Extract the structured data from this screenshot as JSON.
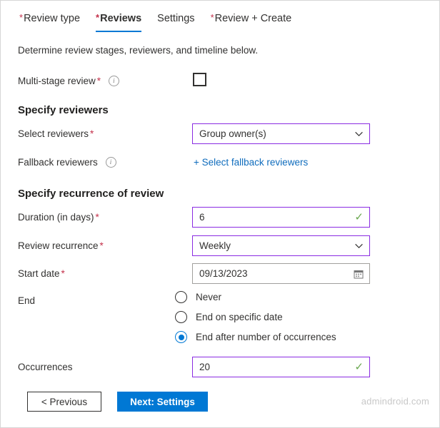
{
  "tabs": [
    {
      "label": "Review type",
      "required": true,
      "active": false
    },
    {
      "label": "Reviews",
      "required": true,
      "active": true
    },
    {
      "label": "Settings",
      "required": false,
      "active": false
    },
    {
      "label": "Review + Create",
      "required": true,
      "active": false
    }
  ],
  "intro": "Determine review stages, reviewers, and timeline below.",
  "multi_stage": {
    "label": "Multi-stage review",
    "required_mark": "*",
    "info_icon": "info-icon",
    "checked": false
  },
  "sections": {
    "reviewers_title": "Specify reviewers",
    "recurrence_title": "Specify recurrence of review"
  },
  "fields": {
    "select_reviewers": {
      "label": "Select reviewers",
      "required_mark": "*",
      "value": "Group owner(s)",
      "icon": "chevron-down-icon"
    },
    "fallback_reviewers": {
      "label": "Fallback reviewers",
      "info_icon": "info-icon",
      "link_label": "+ Select fallback reviewers"
    },
    "duration": {
      "label": "Duration (in days)",
      "required_mark": "*",
      "value": "6",
      "icon": "check-icon"
    },
    "review_recurrence": {
      "label": "Review recurrence",
      "required_mark": "*",
      "value": "Weekly",
      "icon": "chevron-down-icon"
    },
    "start_date": {
      "label": "Start date",
      "required_mark": "*",
      "value": "09/13/2023",
      "icon": "calendar-icon"
    },
    "occurrences": {
      "label": "Occurrences",
      "value": "20",
      "icon": "check-icon"
    }
  },
  "end_group": {
    "label": "End",
    "options": [
      {
        "label": "Never",
        "selected": false
      },
      {
        "label": "End on specific date",
        "selected": false
      },
      {
        "label": "End after number of occurrences",
        "selected": true
      }
    ]
  },
  "footer": {
    "previous_label": "< Previous",
    "next_label": "Next: Settings",
    "watermark": "admindroid.com"
  },
  "colors": {
    "accent_blue": "#0078d4",
    "focus_purple": "#8a2be2",
    "required_red": "#c4314b",
    "valid_green": "#6aa84f",
    "link_blue": "#0f6cbd"
  }
}
